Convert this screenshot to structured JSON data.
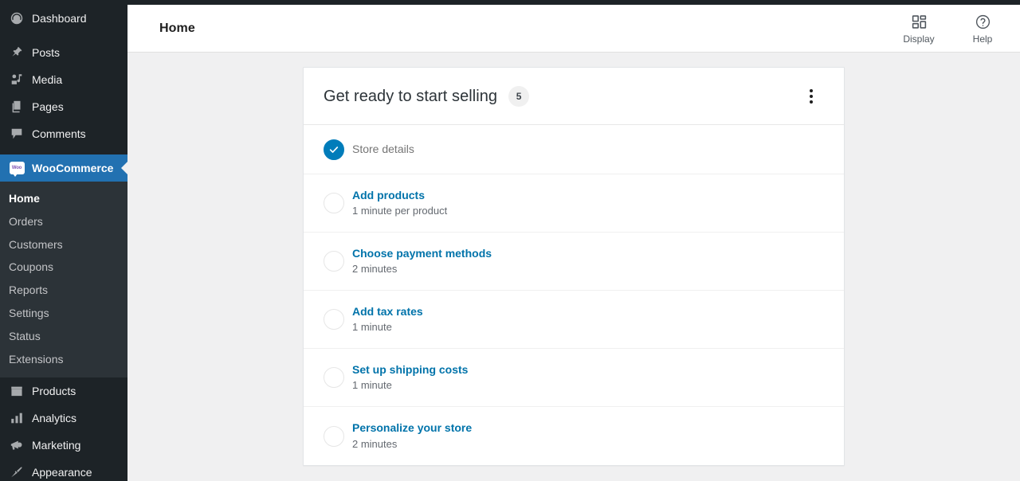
{
  "sidebar": {
    "top_items": [
      {
        "label": "Dashboard",
        "icon": "dashboard-icon",
        "current": false
      },
      {
        "label": "Posts",
        "icon": "pin-icon",
        "current": false
      },
      {
        "label": "Media",
        "icon": "media-icon",
        "current": false
      },
      {
        "label": "Pages",
        "icon": "pages-icon",
        "current": false
      },
      {
        "label": "Comments",
        "icon": "comments-icon",
        "current": false
      }
    ],
    "woocommerce": {
      "label": "WooCommerce",
      "icon": "woocommerce-icon",
      "badge_text": "Woo",
      "current": true
    },
    "submenu": [
      {
        "label": "Home",
        "current": true
      },
      {
        "label": "Orders",
        "current": false
      },
      {
        "label": "Customers",
        "current": false
      },
      {
        "label": "Coupons",
        "current": false
      },
      {
        "label": "Reports",
        "current": false
      },
      {
        "label": "Settings",
        "current": false
      },
      {
        "label": "Status",
        "current": false
      },
      {
        "label": "Extensions",
        "current": false
      }
    ],
    "bottom_items": [
      {
        "label": "Products",
        "icon": "products-icon",
        "current": false
      },
      {
        "label": "Analytics",
        "icon": "analytics-icon",
        "current": false
      },
      {
        "label": "Marketing",
        "icon": "megaphone-icon",
        "current": false
      },
      {
        "label": "Appearance",
        "icon": "paintbrush-icon",
        "current": false
      }
    ]
  },
  "header": {
    "title": "Home",
    "actions": [
      {
        "label": "Display",
        "icon": "layout-grid-icon"
      },
      {
        "label": "Help",
        "icon": "question-circle-icon"
      }
    ]
  },
  "card": {
    "title": "Get ready to start selling",
    "count_badge": "5",
    "menu_icon": "vertical-ellipsis-icon",
    "tasks": [
      {
        "title": "Store details",
        "time": "",
        "completed": true
      },
      {
        "title": "Add products",
        "time": "1 minute per product",
        "completed": false
      },
      {
        "title": "Choose payment methods",
        "time": "2 minutes",
        "completed": false
      },
      {
        "title": "Add tax rates",
        "time": "1 minute",
        "completed": false
      },
      {
        "title": "Set up shipping costs",
        "time": "1 minute",
        "completed": false
      },
      {
        "title": "Personalize your store",
        "time": "2 minutes",
        "completed": false
      }
    ]
  },
  "colors": {
    "sidebar_bg": "#1d2327",
    "submenu_bg": "#2c3338",
    "accent_blue": "#2271b1",
    "link_blue": "#0073aa",
    "check_blue": "#007cba",
    "page_bg": "#f0f0f1"
  }
}
